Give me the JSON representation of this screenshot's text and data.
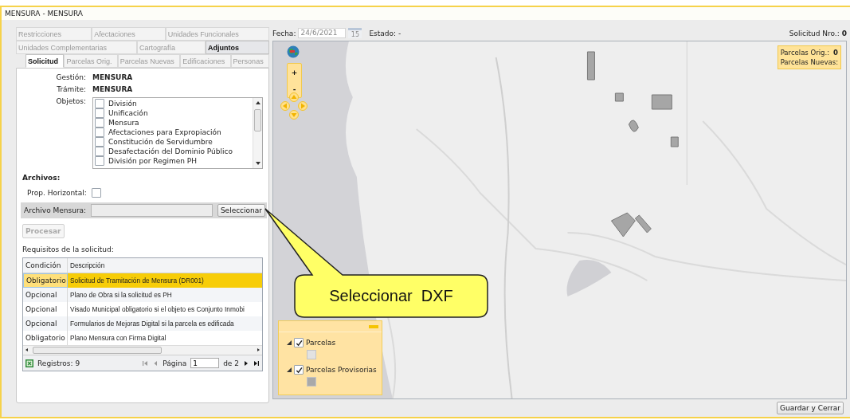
{
  "window": {
    "title": "MENSURA  -  MENSURA"
  },
  "tab_rows": [
    [
      {
        "label": "Restricciones",
        "selected": false
      },
      {
        "label": "Afectaciones",
        "selected": false
      },
      {
        "label": "Unidades Funcionales",
        "selected": false
      }
    ],
    [
      {
        "label": "Unidades Complementarias",
        "selected": false
      },
      {
        "label": "Cartografía",
        "selected": false
      },
      {
        "label": "Adjuntos",
        "selected": true
      }
    ],
    [
      {
        "label": "Solicitud",
        "selected": true
      },
      {
        "label": "Parcelas Orig.",
        "selected": false
      },
      {
        "label": "Parcelas Nuevas",
        "selected": false
      },
      {
        "label": "Edificaciones",
        "selected": false
      },
      {
        "label": "Personas",
        "selected": false
      }
    ]
  ],
  "form": {
    "fields": [
      {
        "label": "Gestión:",
        "value": "MENSURA"
      },
      {
        "label": "Trámite:",
        "value": "MENSURA"
      }
    ],
    "objetos": {
      "label": "Objetos:",
      "items": [
        {
          "label": "División",
          "checked": false
        },
        {
          "label": "Unificación",
          "checked": false
        },
        {
          "label": "Mensura",
          "checked": false
        },
        {
          "label": "Afectaciones para Expropiación",
          "checked": false
        },
        {
          "label": "Constitución de Servidumbre",
          "checked": false
        },
        {
          "label": "Desafectación del Dominio Público",
          "checked": false
        },
        {
          "label": "División por Regimen PH",
          "checked": false
        }
      ]
    }
  },
  "archivos": {
    "title": "Archivos:",
    "prop_horizontal": {
      "label": "Prop. Horizontal:",
      "checked": false
    },
    "archivo_mensura": {
      "label": "Archivo Mensura:",
      "button": "Seleccionar"
    },
    "procesar": {
      "label": "Procesar",
      "disabled": true
    }
  },
  "requisitos": {
    "title": "Requisitos de la solicitud:",
    "columns": [
      "Condición",
      "Descripción"
    ],
    "rows": [
      {
        "condicion": "Obligatorio",
        "descripcion": "Solicitud de Tramitación de Mensura (DR001)",
        "selected": true
      },
      {
        "condicion": "Opcional",
        "descripcion": "Plano de Obra si la solicitud es PH",
        "selected": false
      },
      {
        "condicion": "Opcional",
        "descripcion": "Visado Municipal obligatorio si el objeto es Conjunto Inmobi",
        "selected": false
      },
      {
        "condicion": "Opcional",
        "descripcion": "Formularios de Mejoras Digital si la parcela es edificada",
        "selected": false
      },
      {
        "condicion": "Obligatorio",
        "descripcion": "Plano Mensura con Firma Digital",
        "selected": false
      }
    ],
    "footer": {
      "registros": "Registros: 9",
      "page_label": "Página",
      "page": "1",
      "page_total": "de 2"
    }
  },
  "header": {
    "fecha_label": "Fecha:",
    "fecha": "24/6/2021",
    "calendar_day": "15",
    "estado_label": "Estado:",
    "estado": "-",
    "solicitud_label": "Solicitud Nro.:",
    "solicitud": "0"
  },
  "map": {
    "kind": "picture",
    "zoom_in": "+",
    "zoom_out": "-",
    "legend": [
      {
        "label": "Parcelas",
        "checked": true,
        "expanded": true,
        "color": "#e2e2e2"
      },
      {
        "label": "Parcelas Provisorias",
        "checked": true,
        "expanded": true,
        "color": "#a9a9a9"
      }
    ],
    "info": [
      {
        "label": "Parcelas Orig.:",
        "value": "0"
      },
      {
        "label": "Parcelas Nuevas:"
      }
    ]
  },
  "callout": {
    "text": "Seleccionar  DXF"
  },
  "buttons": {
    "guardar": "Guardar y Cerrar"
  }
}
